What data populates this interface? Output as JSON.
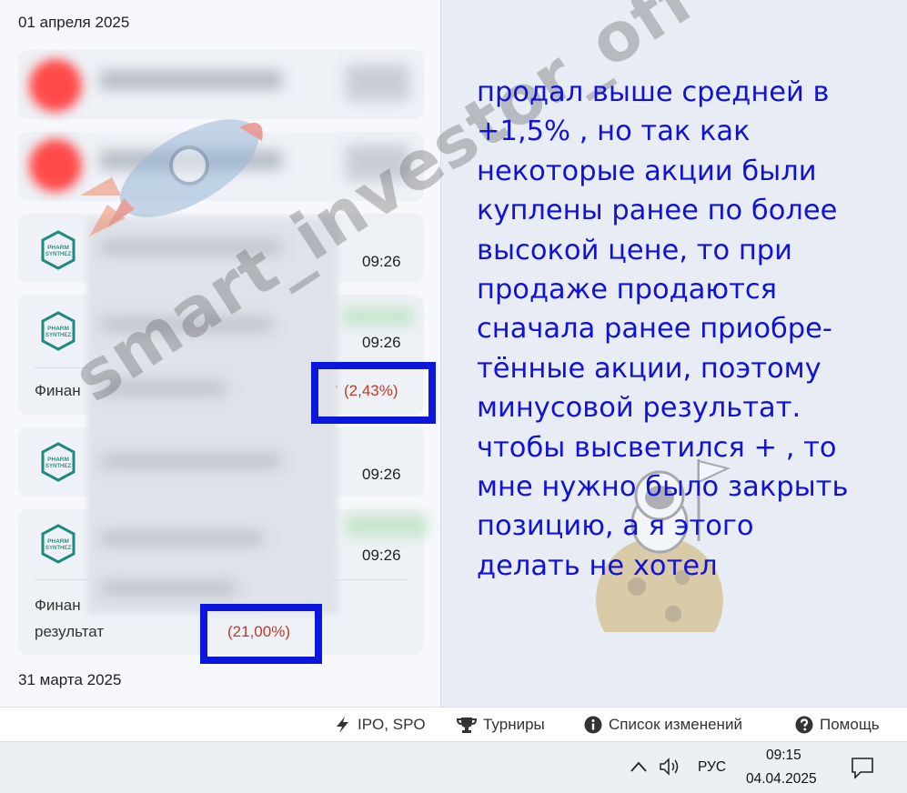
{
  "list": {
    "date_top": "01 апреля 2025",
    "date_bottom": "31 марта 2025",
    "cards": [
      {
        "time": ""
      },
      {
        "time": ""
      },
      {
        "time": "09:26"
      },
      {
        "time": "09:26",
        "label": "Финан",
        "pct": "(2,43%)",
        "pct_prefix": "’"
      },
      {
        "time": "09:26"
      },
      {
        "time": "09:26",
        "label": "Финан",
        "label2": "результат",
        "pct": "(21,00%)"
      }
    ],
    "logo_text": [
      "PHARM",
      "SYNTHEZ"
    ]
  },
  "annotation": {
    "text": "продал выше средней в\n+1,5% , но так как\nнекоторые акции были\nкуплены ранее по более\nвысокой цене, то при\nпродаже продаются\nсначала ранее приобре-\nтённые акции, поэтому\nминусовой результат.\nчтобы высветился + , то\nмне нужно было закрыть\nпозицию, а я этого\nделать не хотел"
  },
  "watermark": "smart_investor_off",
  "footer": {
    "ipo": "IPO, SPO",
    "tournaments": "Турниры",
    "changelog": "Список изменений",
    "help": "Помощь"
  },
  "taskbar": {
    "lang": "РУС",
    "time": "09:15",
    "date": "04.04.2025"
  },
  "colors": {
    "accent_text": "#1212d6",
    "highlight_box": "#0a16dc",
    "negative": "#c0392b"
  }
}
